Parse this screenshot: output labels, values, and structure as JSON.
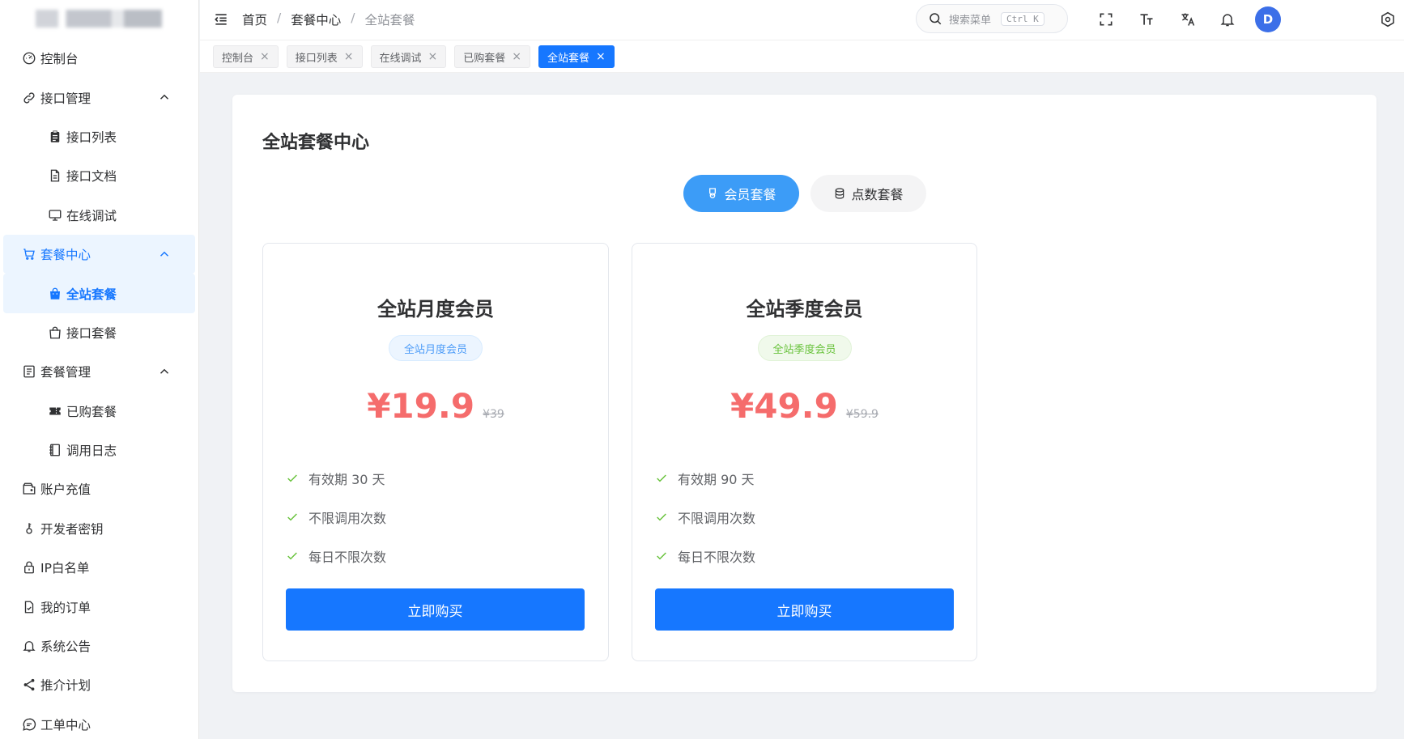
{
  "sidebar": {
    "items": [
      {
        "label": "控制台",
        "icon": "dashboard-icon"
      },
      {
        "label": "接口管理",
        "icon": "link-icon"
      },
      {
        "label": "接口列表",
        "icon": "clipboard-icon"
      },
      {
        "label": "接口文档",
        "icon": "document-icon"
      },
      {
        "label": "在线调试",
        "icon": "monitor-icon"
      },
      {
        "label": "套餐中心",
        "icon": "cart-icon"
      },
      {
        "label": "全站套餐",
        "icon": "shopping-bag-filled-icon"
      },
      {
        "label": "接口套餐",
        "icon": "shopping-bag-icon"
      },
      {
        "label": "套餐管理",
        "icon": "list-icon"
      },
      {
        "label": "已购套餐",
        "icon": "ticket-icon"
      },
      {
        "label": "调用日志",
        "icon": "notebook-icon"
      },
      {
        "label": "账户充值",
        "icon": "wallet-icon"
      },
      {
        "label": "开发者密钥",
        "icon": "key-icon"
      },
      {
        "label": "IP白名单",
        "icon": "lock-icon"
      },
      {
        "label": "我的订单",
        "icon": "order-icon"
      },
      {
        "label": "系统公告",
        "icon": "bell-icon"
      },
      {
        "label": "推介计划",
        "icon": "share-icon"
      },
      {
        "label": "工单中心",
        "icon": "chat-icon"
      }
    ]
  },
  "header": {
    "breadcrumb": [
      "首页",
      "套餐中心",
      "全站套餐"
    ],
    "breadcrumb_sep": "/",
    "search_placeholder": "搜索菜单",
    "search_shortcut": "Ctrl K",
    "avatar_letter": "D"
  },
  "tabs": [
    {
      "label": "控制台"
    },
    {
      "label": "接口列表"
    },
    {
      "label": "在线调试"
    },
    {
      "label": "已购套餐"
    },
    {
      "label": "全站套餐",
      "active": true
    }
  ],
  "tab_close": "×",
  "main": {
    "title": "全站套餐中心",
    "segments": [
      {
        "label": "会员套餐",
        "active": true
      },
      {
        "label": "点数套餐",
        "active": false
      }
    ],
    "packages": [
      {
        "name": "全站月度会员",
        "badge": "全站月度会员",
        "badge_color": "#4d9cf8",
        "price": "¥19.9",
        "original_price": "¥39",
        "features": [
          "有效期 30 天",
          "不限调用次数",
          "每日不限次数"
        ],
        "button": "立即购买"
      },
      {
        "name": "全站季度会员",
        "badge": "全站季度会员",
        "badge_color": "#67c23a",
        "price": "¥49.9",
        "original_price": "¥59.9",
        "features": [
          "有效期 90 天",
          "不限调用次数",
          "每日不限次数"
        ],
        "button": "立即购买"
      }
    ]
  },
  "colors": {
    "primary": "#1677ff",
    "price": "#f56c6c",
    "check": "#67c23a"
  }
}
